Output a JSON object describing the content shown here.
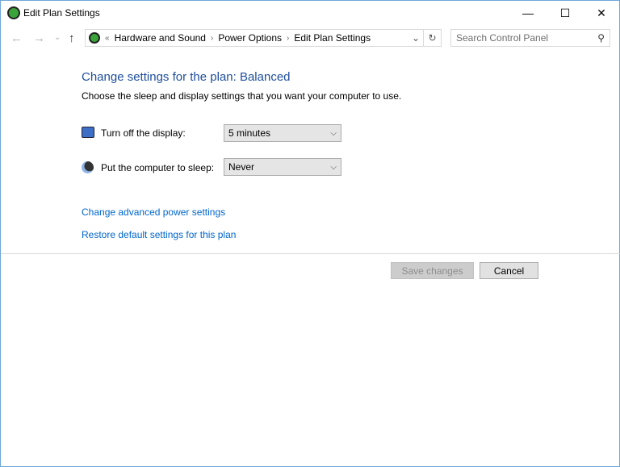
{
  "window": {
    "title": "Edit Plan Settings",
    "minimize": "—",
    "maximize": "☐",
    "close": "✕"
  },
  "nav": {
    "back": "←",
    "forward": "→",
    "recent": "⌄",
    "up": "↑"
  },
  "address": {
    "overflow": "«",
    "crumbs": [
      "Hardware and Sound",
      "Power Options",
      "Edit Plan Settings"
    ],
    "dropdown": "⌄",
    "refresh": "↻"
  },
  "search": {
    "placeholder": "Search Control Panel",
    "icon": "⚲"
  },
  "main": {
    "heading": "Change settings for the plan: Balanced",
    "subheading": "Choose the sleep and display settings that you want your computer to use.",
    "display": {
      "label": "Turn off the display:",
      "value": "5 minutes"
    },
    "sleep": {
      "label": "Put the computer to sleep:",
      "value": "Never"
    },
    "links": [
      "Change advanced power settings",
      "Restore default settings for this plan"
    ]
  },
  "buttons": {
    "save": "Save changes",
    "cancel": "Cancel"
  }
}
